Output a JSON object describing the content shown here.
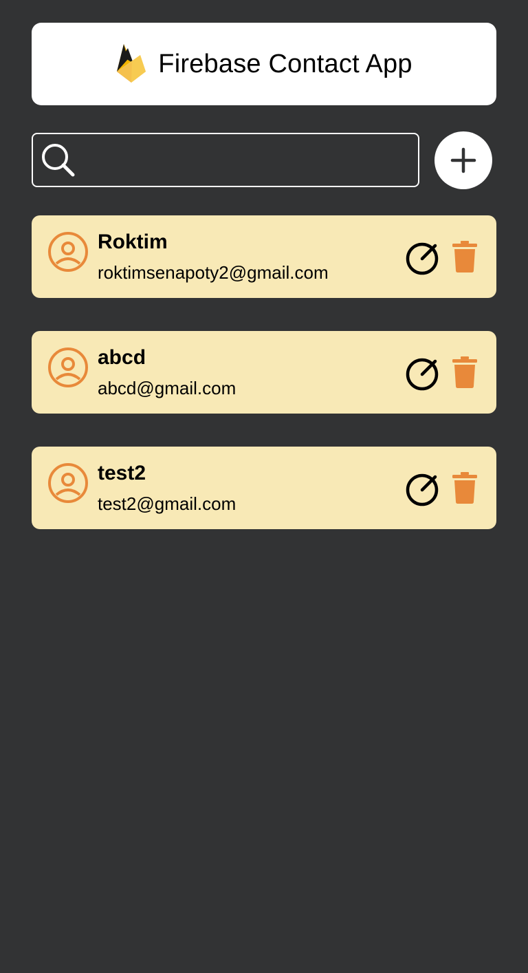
{
  "header": {
    "title": "Firebase Contact App"
  },
  "search": {
    "value": "",
    "placeholder": ""
  },
  "add_button": {
    "icon": "plus-icon"
  },
  "contacts": [
    {
      "name": "Roktim",
      "email": "roktimsenapoty2@gmail.com"
    },
    {
      "name": "abcd",
      "email": "abcd@gmail.com"
    },
    {
      "name": "test2",
      "email": "test2@gmail.com"
    }
  ],
  "colors": {
    "background": "#323334",
    "card": "#f8e9b6",
    "accent": "#e8893a",
    "header": "#ffffff"
  }
}
